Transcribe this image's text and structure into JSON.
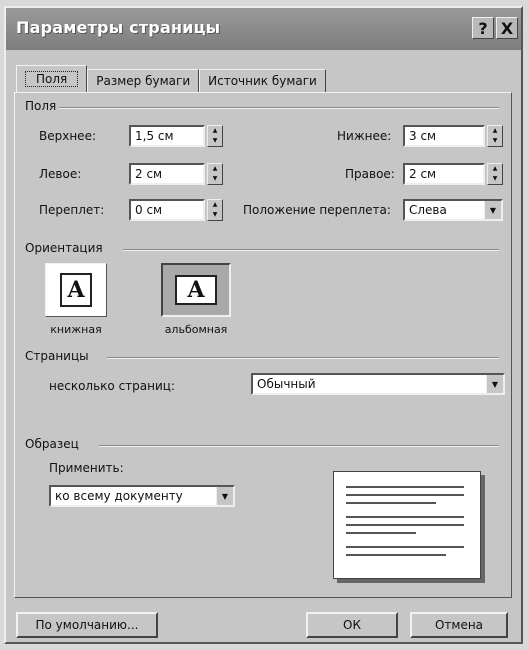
{
  "window": {
    "title": "Параметры страницы"
  },
  "titlebar": {
    "help_glyph": "?",
    "close_glyph": "X"
  },
  "tabs": [
    {
      "label": "Поля"
    },
    {
      "label": "Размер бумаги"
    },
    {
      "label": "Источник бумаги"
    }
  ],
  "margins": {
    "legend": "Поля",
    "top_label": "Верхнее:",
    "top_value": "1,5 см",
    "bottom_label": "Нижнее:",
    "bottom_value": "3 см",
    "left_label": "Левое:",
    "left_value": "2 см",
    "right_label": "Правое:",
    "right_value": "2 см",
    "gutter_label": "Переплет:",
    "gutter_value": "0 см",
    "gutter_pos_label": "Положение переплета:",
    "gutter_pos_value": "Слева"
  },
  "orientation": {
    "legend": "Ориентация",
    "portrait_label": "книжная",
    "landscape_label": "альбомная",
    "icon_letter": "A"
  },
  "pages": {
    "legend": "Страницы",
    "multiple_label": "несколько страниц:",
    "multiple_value": "Обычный"
  },
  "sample": {
    "legend": "Образец",
    "apply_label": "Применить:",
    "apply_value": "ко всему документу"
  },
  "buttons": {
    "default": "По умолчанию...",
    "ok": "ОК",
    "cancel": "Отмена"
  }
}
